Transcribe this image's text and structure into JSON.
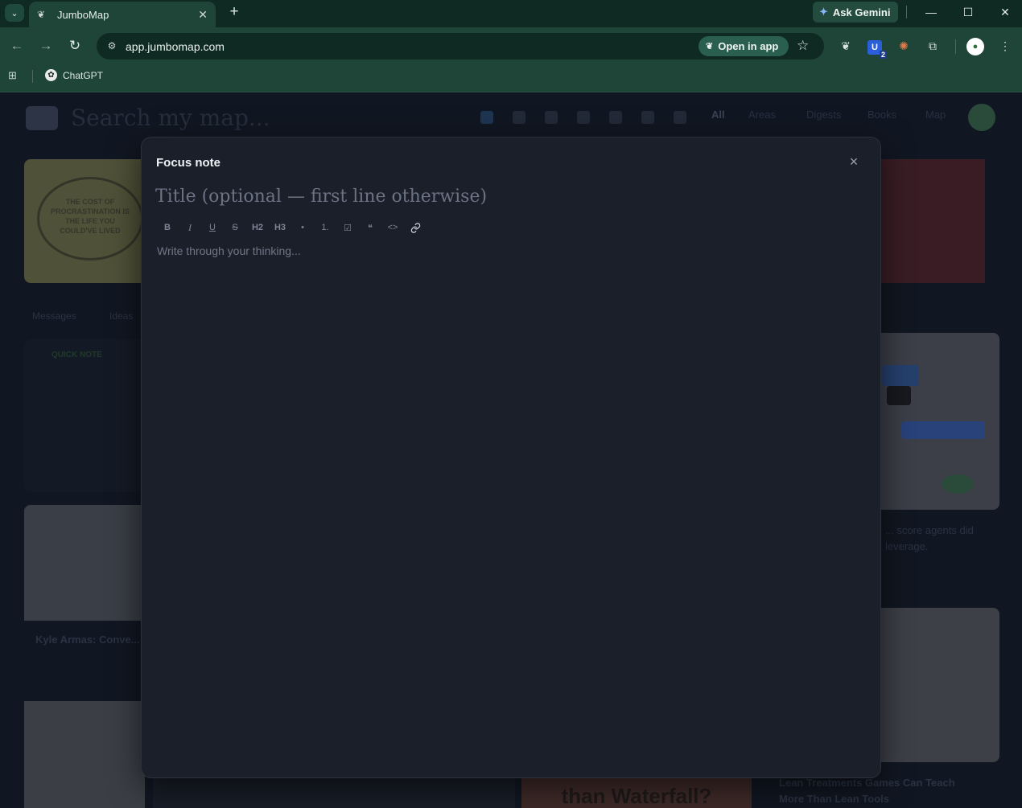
{
  "browser": {
    "tab_title": "JumboMap",
    "tab_close": "✕",
    "new_tab": "+",
    "ask_gemini": "Ask Gemini",
    "url": "app.jumbomap.com",
    "open_in_app": "Open in app",
    "extension_badge_count": "2",
    "bookmark_label": "ChatGPT",
    "window_minimize": "—",
    "window_maximize": "☐",
    "window_close": "✕"
  },
  "app_background": {
    "search_placeholder": "Search my map...",
    "filters": [
      "All",
      "Areas",
      "Digests",
      "Books",
      "Map"
    ],
    "chips": [
      "Messages",
      "Ideas"
    ],
    "quote_image_text": "THE COST OF PROCRASTINATION IS THE LIFE YOU COULD'VE LIVED",
    "quick_note_label": "QUICK NOTE",
    "right_caption_line1": "... score agents did",
    "right_caption_line2": "leverage.",
    "left_caption": "Kyle Armas: Conve...",
    "bottom_caption_line1": "Lean Treatments Games Can Teach",
    "bottom_caption_line2": "More Than Lean Tools",
    "bottom_image_text": "than Waterfall?"
  },
  "modal": {
    "title": "Focus note",
    "close_icon": "×",
    "title_placeholder": "Title (optional — first line otherwise)",
    "body_placeholder": "Write through your thinking...",
    "toolbar": [
      {
        "name": "bold-button",
        "label": "B"
      },
      {
        "name": "italic-button",
        "label": "I"
      },
      {
        "name": "underline-button",
        "label": "U"
      },
      {
        "name": "strikethrough-button",
        "label": "S"
      },
      {
        "name": "heading2-button",
        "label": "H2"
      },
      {
        "name": "heading3-button",
        "label": "H3"
      },
      {
        "name": "bullet-list-button",
        "label": "•"
      },
      {
        "name": "ordered-list-button",
        "label": "1."
      },
      {
        "name": "checklist-button",
        "label": "☑"
      },
      {
        "name": "quote-button",
        "label": "❝"
      },
      {
        "name": "code-button",
        "label": "<>"
      },
      {
        "name": "link-button",
        "label": "🔗"
      }
    ]
  }
}
